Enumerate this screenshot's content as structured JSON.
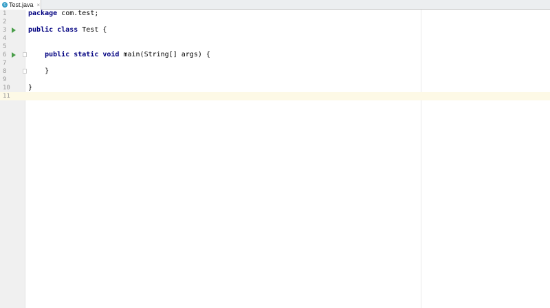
{
  "tab": {
    "title": "Test.java",
    "icon": "java-class-icon",
    "close": "×"
  },
  "lines": [
    {
      "n": "1",
      "kw": "package",
      "rest": " com.test;"
    },
    {
      "n": "2"
    },
    {
      "n": "3",
      "kw": "public class",
      "rest": " Test {",
      "run": true
    },
    {
      "n": "4"
    },
    {
      "n": "5"
    },
    {
      "n": "6",
      "kw": "    public static void",
      "rest": " main(String[] args) {",
      "run": true,
      "fold": true
    },
    {
      "n": "7"
    },
    {
      "n": "8",
      "rest": "    }",
      "fold": true
    },
    {
      "n": "9"
    },
    {
      "n": "10",
      "rest": "}"
    },
    {
      "n": "11",
      "current": true
    }
  ],
  "colors": {
    "keyword": "#000080",
    "current_line": "#fdf9e6",
    "run": "#4a9e4a"
  }
}
